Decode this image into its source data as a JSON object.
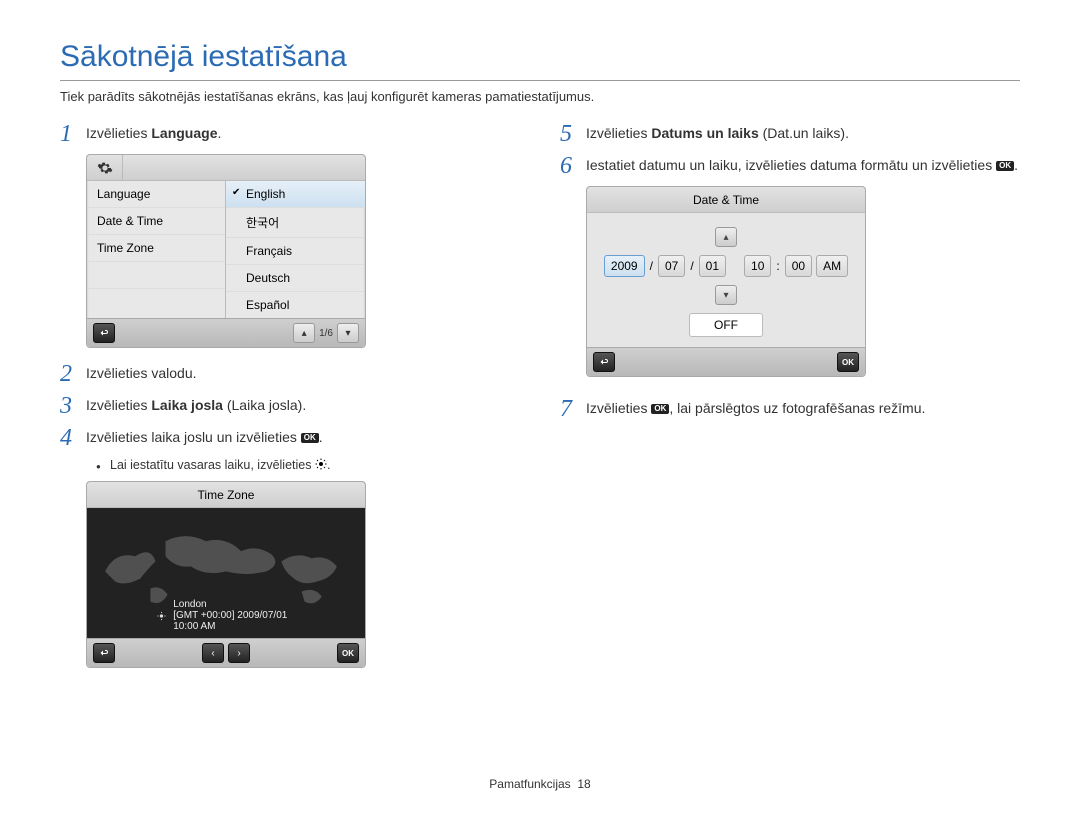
{
  "title": "Sākotnējā iestatīšana",
  "intro": "Tiek parādīts sākotnējās iestatīšanas ekrāns, kas ļauj konfigurēt kameras pamatiestatījumus.",
  "steps": {
    "s1": {
      "num": "1",
      "pre": "Izvēlieties ",
      "b": "Language",
      "post": "."
    },
    "s2": {
      "num": "2",
      "text": "Izvēlieties valodu."
    },
    "s3": {
      "num": "3",
      "pre": "Izvēlieties ",
      "b": "Laika josla",
      "post": " (Laika josla)."
    },
    "s4": {
      "num": "4",
      "pre": "Izvēlieties laika joslu un izvēlieties ",
      "post": "."
    },
    "s4_bullet_pre": "Lai iestatītu vasaras laiku, izvēlieties ",
    "s4_bullet_post": ".",
    "s5": {
      "num": "5",
      "pre": "Izvēlieties ",
      "b": "Datums un laiks",
      "post": " (Dat.un laiks)."
    },
    "s6": {
      "num": "6",
      "pre": "Iestatiet datumu un laiku, izvēlieties datuma formātu un izvēlieties ",
      "post": "."
    },
    "s7": {
      "num": "7",
      "pre": "Izvēlieties ",
      "post": ", lai pārslēgtos uz fotografēšanas režīmu."
    }
  },
  "lang_ui": {
    "left": {
      "language": "Language",
      "datetime": "Date & Time",
      "timezone": "Time Zone"
    },
    "right": {
      "english": "English",
      "korean": "한국어",
      "francais": "Français",
      "deutsch": "Deutsch",
      "espanol": "Español"
    },
    "pager": "1/6"
  },
  "tz_ui": {
    "title": "Time Zone",
    "city": "London",
    "gmt": "[GMT +00:00] 2009/07/01 10:00 AM"
  },
  "dt_ui": {
    "title": "Date & Time",
    "year": "2009",
    "mon": "07",
    "day": "01",
    "hour": "10",
    "min": "00",
    "ampm": "AM",
    "off": "OFF"
  },
  "ok_label": "OK",
  "footer": {
    "section": "Pamatfunkcijas",
    "page": "18"
  }
}
